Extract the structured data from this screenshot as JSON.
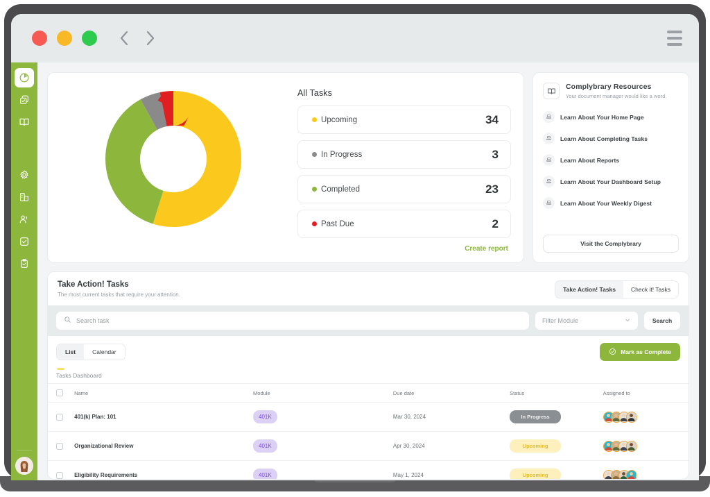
{
  "window": {
    "traffic_lights": [
      "close",
      "minimize",
      "maximize"
    ],
    "back_label": "Back",
    "forward_label": "Forward",
    "menu_label": "Menu"
  },
  "sidebar": {
    "items": [
      {
        "icon": "pie-chart-icon",
        "label": "Dashboard",
        "active": true
      },
      {
        "icon": "copy-tasks-icon",
        "label": "Tasks",
        "active": false
      },
      {
        "icon": "book-icon",
        "label": "Library",
        "active": false
      },
      {
        "icon": "gear-icon",
        "label": "Settings",
        "active": false
      },
      {
        "icon": "building-report-icon",
        "label": "Reports",
        "active": false
      },
      {
        "icon": "users-icon",
        "label": "People",
        "active": false
      },
      {
        "icon": "checkbox-square-icon",
        "label": "Checklists",
        "active": false
      },
      {
        "icon": "clipboard-check-icon",
        "label": "Audits",
        "active": false
      }
    ],
    "avatar_label": "User avatar"
  },
  "stats": {
    "title": "All Tasks",
    "create_report_label": "Create report",
    "items": [
      {
        "label": "Upcoming",
        "value": "34",
        "color": "#fbc81e"
      },
      {
        "label": "In Progress",
        "value": "3",
        "color": "#8a8a8a"
      },
      {
        "label": "Completed",
        "value": "23",
        "color": "#8cb63c"
      },
      {
        "label": "Past Due",
        "value": "2",
        "color": "#e02020"
      }
    ]
  },
  "chart_data": {
    "type": "pie",
    "title": "All Tasks",
    "variant": "donut",
    "categories": [
      "Upcoming",
      "In Progress",
      "Completed",
      "Past Due"
    ],
    "values": [
      34,
      3,
      23,
      2
    ],
    "colors": [
      "#fbc81e",
      "#8a8a8a",
      "#8cb63c",
      "#e02020"
    ],
    "total": 62,
    "legend_position": "right",
    "inner_radius_ratio": 0.45,
    "grid": false
  },
  "resources": {
    "icon": "book-icon",
    "title": "Complybrary Resources",
    "subtitle": "Your document manager would like a word.",
    "links": [
      {
        "icon": "stamp-icon",
        "label": "Learn About Your Home Page"
      },
      {
        "icon": "stamp-icon",
        "label": "Learn About Completing Tasks"
      },
      {
        "icon": "stamp-icon",
        "label": "Learn About Reports"
      },
      {
        "icon": "stamp-icon",
        "label": "Learn About Your Dashboard Setup"
      },
      {
        "icon": "stamp-icon",
        "label": "Learn About Your Weekly Digest"
      }
    ],
    "button_label": "Visit the Complybrary"
  },
  "tasks": {
    "title": "Take Action! Tasks",
    "subtitle": "The most current tasks that require your attention.",
    "tabs": [
      {
        "label": "Take Action! Tasks",
        "active": true
      },
      {
        "label": "Check it! Tasks",
        "active": false
      }
    ],
    "search_placeholder": "Search task",
    "search_value": "",
    "filter_placeholder": "Filter Module",
    "filter_value": "",
    "search_button_label": "Search",
    "views": [
      {
        "label": "List",
        "active": true
      },
      {
        "label": "Calendar",
        "active": false
      }
    ],
    "mark_complete_label": "Mark as Complete",
    "breadcrumb": "Tasks Dashboard",
    "columns": [
      "Name",
      "Module",
      "Due date",
      "Status",
      "Assigned to"
    ],
    "rows": [
      {
        "checked": false,
        "name": "401(k) Plan: 101",
        "module": "401K",
        "due_date": "Mar 30, 2024",
        "status": "In Progress",
        "status_kind": "inprogress",
        "assignees": 4
      },
      {
        "checked": false,
        "name": "Organizational Review",
        "module": "401K",
        "due_date": "Apr 30, 2024",
        "status": "Upcoming",
        "status_kind": "upcoming",
        "assignees": 4
      },
      {
        "checked": false,
        "name": "Eligibility Requirements",
        "module": "401K",
        "due_date": "May 1, 2024",
        "status": "Upcoming",
        "status_kind": "upcoming",
        "assignees": 4
      }
    ]
  },
  "colors": {
    "brand_green": "#8cb63c",
    "yellow": "#fbc81e",
    "gray": "#8a8a8a",
    "red": "#e02020",
    "purple_pill_bg": "#ddd0f5",
    "purple_pill_text": "#7a4fd6"
  }
}
